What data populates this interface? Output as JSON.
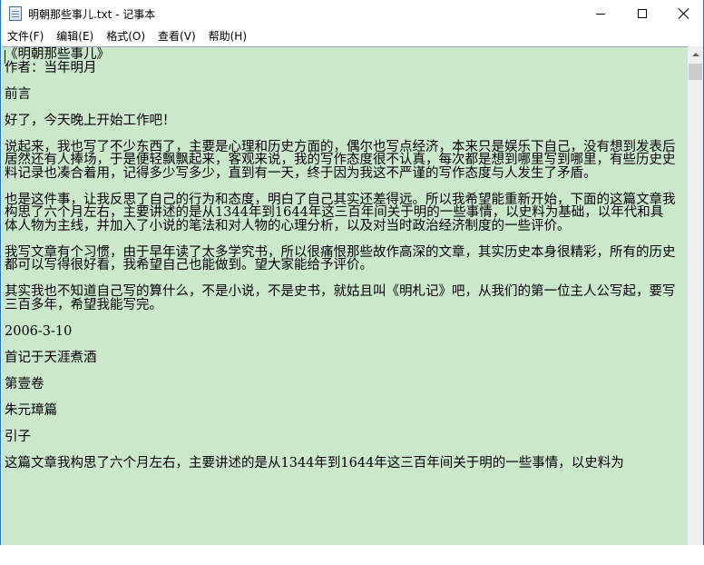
{
  "window": {
    "title": "明朝那些事儿.txt - 记事本"
  },
  "menu": [
    {
      "label": "文件(F)"
    },
    {
      "label": "编辑(E)"
    },
    {
      "label": "格式(O)"
    },
    {
      "label": "查看(V)"
    },
    {
      "label": "帮助(H)"
    }
  ],
  "editor": {
    "background": "#cce8cc",
    "content": "《明朝那些事儿》\n作者：当年明月\n\n前言\n\n好了，今天晚上开始工作吧！\n\n说起来，我也写了不少东西了，主要是心理和历史方面的，偶尔也写点经济，本来只是娱乐下自己，没有想到发表后居然还有人捧场，于是便轻飘飘起来，客观来说，我的写作态度很不认真，每次都是想到哪里写到哪里，有些历史史料记录也凑合着用，记得多少写多少，直到有一天，终于因为我这不严谨的写作态度与人发生了矛盾。\n\n也是这件事，让我反思了自己的行为和态度，明白了自己其实还差得远。所以我希望能重新开始，下面的这篇文章我构思了六个月左右，主要讲述的是从1344年到1644年这三百年间关于明的一些事情，以史料为基础，以年代和具体人物为主线，并加入了小说的笔法和对人物的心理分析，以及对当时政治经济制度的一些评价。\n\n我写文章有个习惯，由于早年读了太多学究书，所以很痛恨那些故作高深的文章，其实历史本身很精彩，所有的历史都可以写得很好看，我希望自己也能做到。望大家能给予评价。\n\n其实我也不知道自己写的算什么，不是小说，不是史书，就姑且叫《明札记》吧，从我们的第一位主人公写起，要写三百多年，希望我能写完。\n\n2006-3-10\n\n首记于天涯煮酒\n\n第壹卷\n\n朱元璋篇\n\n引子\n\n这篇文章我构思了六个月左右，主要讲述的是从1344年到1644年这三百年间关于明的一些事情，以史料为"
  }
}
